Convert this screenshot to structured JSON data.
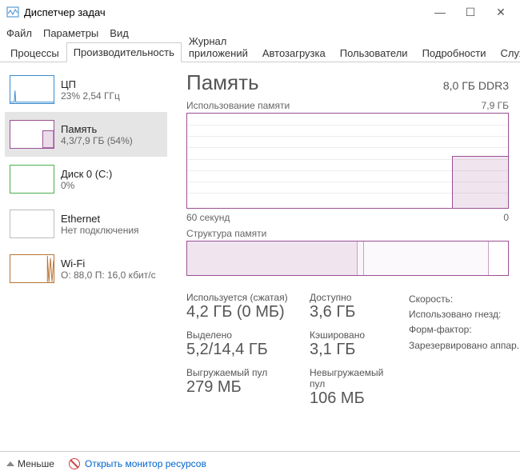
{
  "window": {
    "title": "Диспетчер задач"
  },
  "menu": {
    "file": "Файл",
    "options": "Параметры",
    "view": "Вид"
  },
  "tabs": {
    "processes": "Процессы",
    "performance": "Производительность",
    "apphistory": "Журнал приложений",
    "startup": "Автозагрузка",
    "users": "Пользователи",
    "details": "Подробности",
    "services": "Службы"
  },
  "sidebar": {
    "cpu": {
      "label": "ЦП",
      "sub": "23% 2,54 ГГц"
    },
    "memory": {
      "label": "Память",
      "sub": "4,3/7,9 ГБ (54%)"
    },
    "disk": {
      "label": "Диск 0 (C:)",
      "sub": "0%"
    },
    "ethernet": {
      "label": "Ethernet",
      "sub": "Нет подключения"
    },
    "wifi": {
      "label": "Wi-Fi",
      "sub": "О: 88,0 П: 16,0 кбит/с"
    }
  },
  "memory_view": {
    "title": "Память",
    "installed": "8,0 ГБ DDR3",
    "usage_label": "Использование памяти",
    "usage_max": "7,9 ГБ",
    "x_left": "60 секунд",
    "x_right": "0",
    "composition_label": "Структура памяти",
    "stats": {
      "in_use_label": "Используется (сжатая)",
      "in_use_value": "4,2 ГБ (0 МБ)",
      "committed_label": "Выделено",
      "committed_value": "5,2/14,4 ГБ",
      "paged_label": "Выгружаемый пул",
      "paged_value": "279 МБ",
      "available_label": "Доступно",
      "available_value": "3,6 ГБ",
      "cached_label": "Кэшировано",
      "cached_value": "3,1 ГБ",
      "nonpaged_label": "Невыгружаемый пул",
      "nonpaged_value": "106 МБ"
    },
    "specs": {
      "speed": "Скорость:",
      "slots": "Использовано гнезд:",
      "form": "Форм-фактор:",
      "reserved": "Зарезервировано аппар..."
    }
  },
  "statusbar": {
    "fewer": "Меньше",
    "open_monitor": "Открыть монитор ресурсов"
  },
  "chart_data": {
    "type": "line",
    "title": "Использование памяти",
    "ylabel": "ГБ",
    "ylim": [
      0,
      7.9
    ],
    "xlim_seconds": [
      60,
      0
    ],
    "values_gb": [
      0,
      0,
      0,
      0,
      0,
      0,
      0,
      0,
      0,
      0,
      0,
      0,
      0,
      0,
      0,
      0,
      0,
      0,
      0,
      0,
      0,
      0,
      0,
      0,
      0,
      0,
      0,
      0,
      0,
      0,
      0,
      0,
      0,
      0,
      0,
      0,
      0,
      0,
      0,
      0,
      0,
      0,
      0,
      0,
      0,
      0,
      0,
      0,
      0,
      0,
      4.3,
      4.3,
      4.3,
      4.3,
      4.3,
      4.3,
      4.3,
      4.3,
      4.3,
      4.3
    ]
  },
  "composition_data": {
    "type": "bar",
    "total_gb": 7.9,
    "segments": [
      {
        "name": "in_use",
        "gb": 4.2
      },
      {
        "name": "modified",
        "gb": 0.1
      },
      {
        "name": "standby",
        "gb": 3.1
      },
      {
        "name": "free",
        "gb": 0.5
      }
    ]
  }
}
